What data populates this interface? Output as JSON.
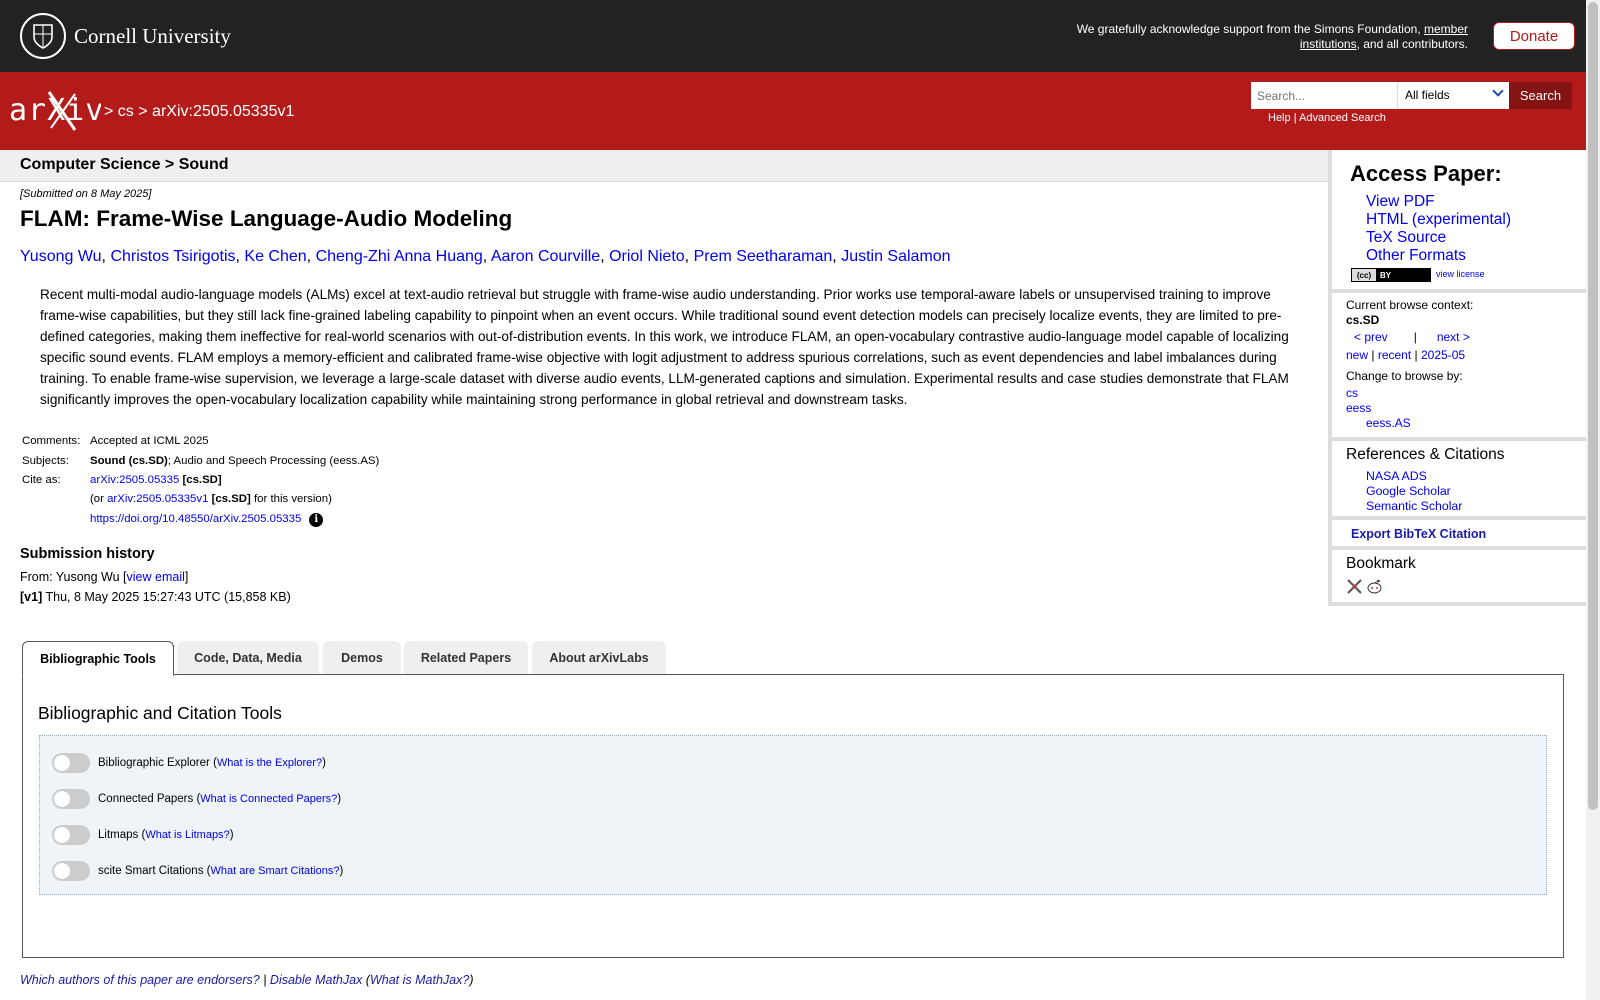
{
  "header": {
    "university": "Cornell University",
    "support_text_prefix": "We gratefully acknowledge support from the Simons Foundation, ",
    "support_link": "member institutions",
    "support_text_suffix": ", and all contributors.",
    "donate_label": "Donate"
  },
  "nav": {
    "logo_text": "arXiv",
    "crumb_sep1": ">",
    "crumb_cs": "cs",
    "crumb_sep2": ">",
    "crumb_id": "arXiv:2505.05335v1",
    "search_placeholder": "Search...",
    "search_field_selected": "All fields",
    "search_button": "Search",
    "help": "Help",
    "divider": "|",
    "advanced": "Advanced Search"
  },
  "subheader": "Computer Science > Sound",
  "paper": {
    "submitted": "[Submitted on 8 May 2025]",
    "title": "FLAM: Frame-Wise Language-Audio Modeling",
    "authors": [
      "Yusong Wu",
      "Christos Tsirigotis",
      "Ke Chen",
      "Cheng-Zhi Anna Huang",
      "Aaron Courville",
      "Oriol Nieto",
      "Prem Seetharaman",
      "Justin Salamon"
    ],
    "abstract": "Recent multi-modal audio-language models (ALMs) excel at text-audio retrieval but struggle with frame-wise audio understanding. Prior works use temporal-aware labels or unsupervised training to improve frame-wise capabilities, but they still lack fine-grained labeling capability to pinpoint when an event occurs. While traditional sound event detection models can precisely localize events, they are limited to pre-defined categories, making them ineffective for real-world scenarios with out-of-distribution events. In this work, we introduce FLAM, an open-vocabulary contrastive audio-language model capable of localizing specific sound events. FLAM employs a memory-efficient and calibrated frame-wise objective with logit adjustment to address spurious correlations, such as event dependencies and label imbalances during training. To enable frame-wise supervision, we leverage a large-scale dataset with diverse audio events, LLM-generated captions and simulation. Experimental results and case studies demonstrate that FLAM significantly improves the open-vocabulary localization capability while maintaining strong performance in global retrieval and downstream tasks."
  },
  "meta": {
    "comments_label": "Comments:",
    "comments": "Accepted at ICML 2025",
    "subjects_label": "Subjects:",
    "subjects_primary": "Sound (cs.SD)",
    "subjects_rest": "; Audio and Speech Processing (eess.AS)",
    "cite_label": "Cite as:",
    "cite_id": "arXiv:2505.05335",
    "cite_cat": " [cs.SD]",
    "cite_or": "(or ",
    "cite_version": "arXiv:2505.05335v1",
    "cite_version_cat": " [cs.SD]",
    "cite_version_suffix": " for this version)",
    "doi": "https://doi.org/10.48550/arXiv.2505.05335"
  },
  "history": {
    "title": "Submission history",
    "from_prefix": "From: Yusong Wu [",
    "view_email": "view email",
    "from_suffix": "]",
    "v1_label": "[v1]",
    "v1_text": " Thu, 8 May 2025 15:27:43 UTC (15,858 KB)"
  },
  "sidebar": {
    "access_title": "Access Paper:",
    "formats": [
      "View PDF",
      "HTML (experimental)",
      "TeX Source",
      "Other Formats"
    ],
    "license_badge": "BY",
    "view_license": "view license",
    "current_context_label": "Current browse context:",
    "current_context": "cs.SD",
    "prev": "< prev",
    "sep": "|",
    "next": "next >",
    "new": "new",
    "recent": "recent",
    "month": "2025-05",
    "change_label": "Change to browse by:",
    "browse_cs": "cs",
    "browse_eess": "eess",
    "browse_eessas": "eess.AS",
    "refs_title": "References & Citations",
    "refs": [
      "NASA ADS",
      "Google Scholar",
      "Semantic Scholar"
    ],
    "export": "Export BibTeX Citation",
    "bookmark_title": "Bookmark"
  },
  "tabs": [
    "Bibliographic Tools",
    "Code, Data, Media",
    "Demos",
    "Related Papers",
    "About arXivLabs"
  ],
  "tools": {
    "title": "Bibliographic and Citation Tools",
    "rows": [
      {
        "label": "Bibliographic Explorer",
        "link": "What is the Explorer?"
      },
      {
        "label": "Connected Papers",
        "link": "What is Connected Papers?"
      },
      {
        "label": "Litmaps",
        "link": "What is Litmaps?"
      },
      {
        "label": "scite Smart Citations",
        "link": "What are Smart Citations?"
      }
    ]
  },
  "footer": {
    "endorsers": "Which authors of this paper are endorsers?",
    "sep": " | ",
    "mathjax": "Disable MathJax",
    "what_prefix": " (",
    "what_mathjax": "What is MathJax?",
    "what_suffix": ")"
  }
}
